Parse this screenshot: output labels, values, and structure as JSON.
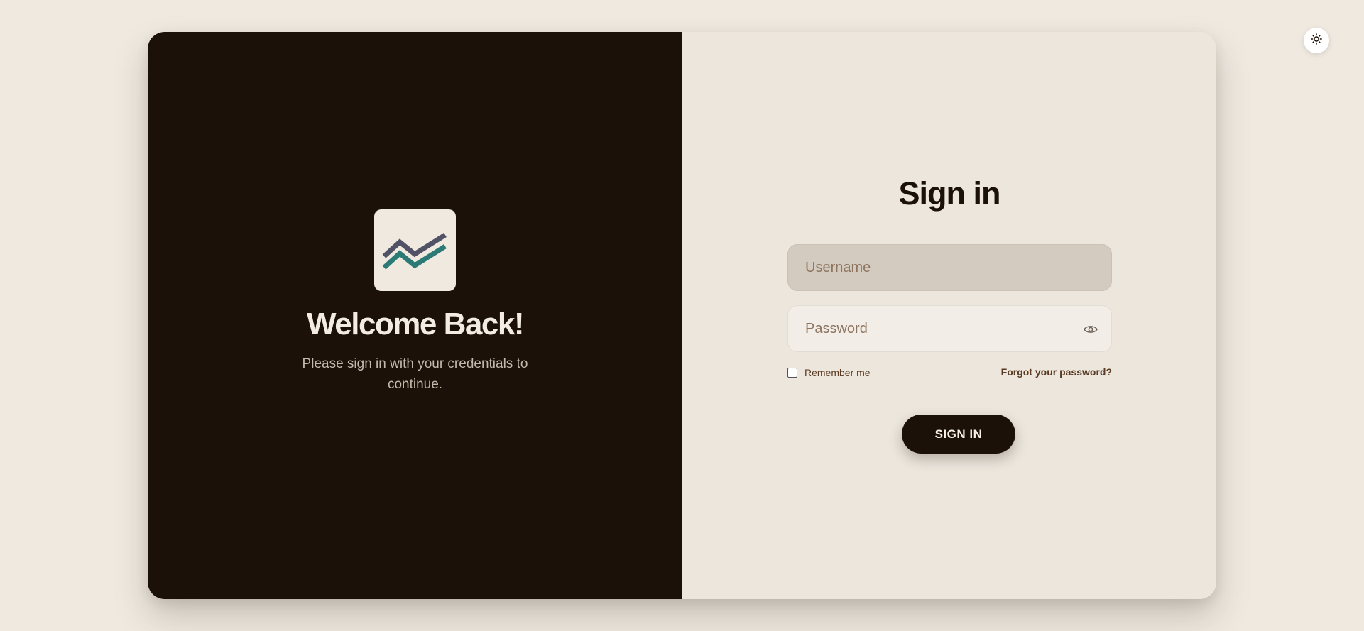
{
  "theme_toggle": {
    "icon": "sun-icon"
  },
  "left_panel": {
    "logo_icon": "zigzag-chart-logo",
    "colors": {
      "zigzag_top": "#525266",
      "zigzag_bottom": "#2c7a76"
    },
    "title": "Welcome Back!",
    "subtitle": "Please sign in with your credentials to continue."
  },
  "right_panel": {
    "title": "Sign in",
    "username": {
      "placeholder": "Username",
      "value": ""
    },
    "password": {
      "placeholder": "Password",
      "value": "",
      "toggle_icon": "eye-icon"
    },
    "remember_me": {
      "label": "Remember me",
      "checked": false
    },
    "forgot_password": "Forgot your password?",
    "submit_label": "SIGN IN"
  },
  "colors": {
    "page_background": "#efe9e0",
    "dark_panel": "#1b1109",
    "light_panel": "#ece6dd",
    "accent_text": "#5a3a22"
  }
}
